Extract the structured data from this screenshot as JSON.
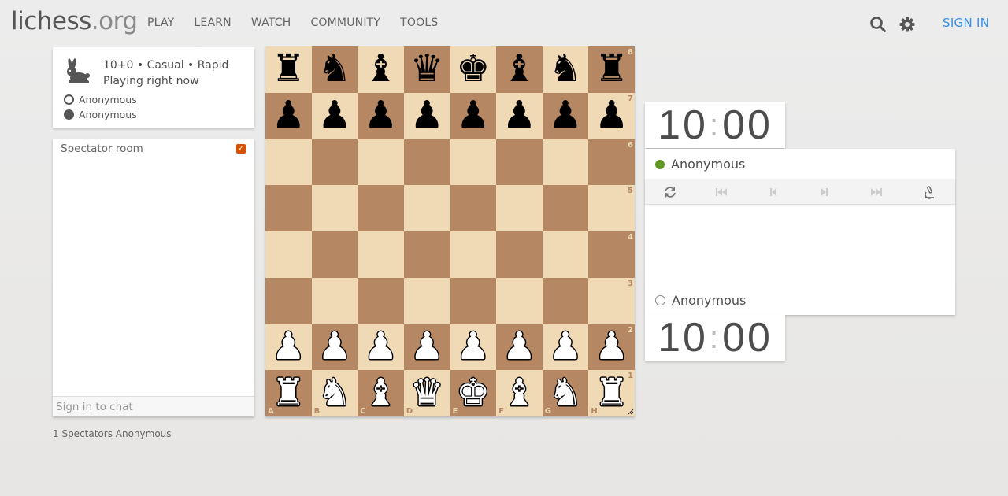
{
  "header": {
    "logo_main": "lichess",
    "logo_tld": ".org",
    "nav": [
      "PLAY",
      "LEARN",
      "WATCH",
      "COMMUNITY",
      "TOOLS"
    ],
    "sign_in": "SIGN IN"
  },
  "game": {
    "setup": "10+0 • Casual • Rapid",
    "status": "Playing right now",
    "white_player": "Anonymous",
    "black_player": "Anonymous"
  },
  "chat": {
    "title": "Spectator room",
    "placeholder": "Sign in to chat"
  },
  "spectators": "1 Spectators Anonymous",
  "board": {
    "ranks": [
      "8",
      "7",
      "6",
      "5",
      "4",
      "3",
      "2",
      "1"
    ],
    "files": [
      "A",
      "B",
      "C",
      "D",
      "E",
      "F",
      "G",
      "H"
    ],
    "position": [
      [
        "bR",
        "bN",
        "bB",
        "bQ",
        "bK",
        "bB",
        "bN",
        "bR"
      ],
      [
        "bP",
        "bP",
        "bP",
        "bP",
        "bP",
        "bP",
        "bP",
        "bP"
      ],
      [
        "",
        "",
        "",
        "",
        "",
        "",
        "",
        ""
      ],
      [
        "",
        "",
        "",
        "",
        "",
        "",
        "",
        ""
      ],
      [
        "",
        "",
        "",
        "",
        "",
        "",
        "",
        ""
      ],
      [
        "",
        "",
        "",
        "",
        "",
        "",
        "",
        ""
      ],
      [
        "wP",
        "wP",
        "wP",
        "wP",
        "wP",
        "wP",
        "wP",
        "wP"
      ],
      [
        "wR",
        "wN",
        "wB",
        "wQ",
        "wK",
        "wB",
        "wN",
        "wR"
      ]
    ]
  },
  "clocks": {
    "top_min": "10",
    "top_sec": "00",
    "bottom_min": "10",
    "bottom_sec": "00"
  },
  "table": {
    "top_player": "Anonymous",
    "bottom_player": "Anonymous"
  },
  "colors": {
    "light_square": "#f0d9b5",
    "dark_square": "#b58863",
    "link": "#3692e7",
    "online": "#629924",
    "accent": "#d85000"
  }
}
